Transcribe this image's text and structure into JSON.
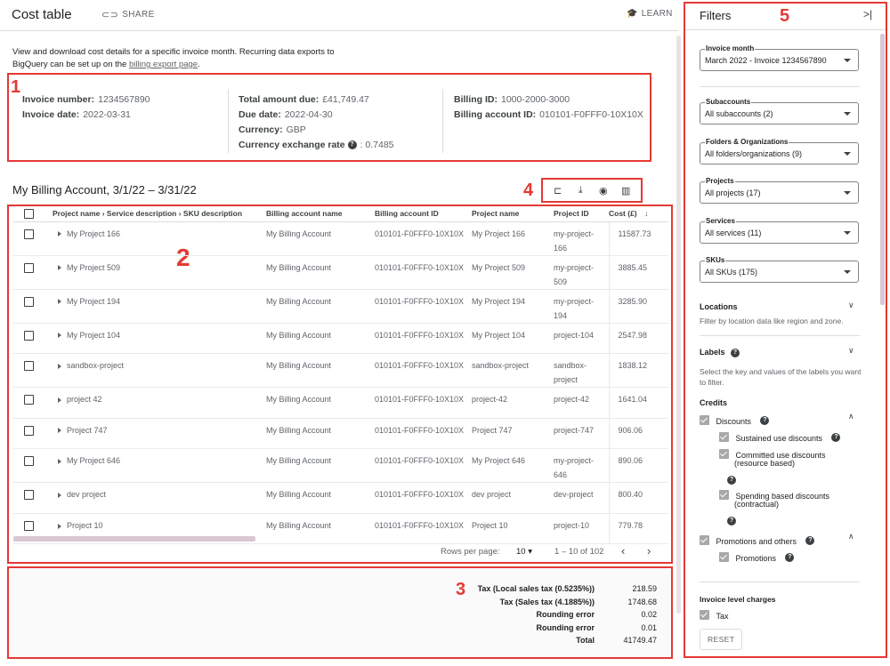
{
  "header": {
    "title": "Cost table",
    "share": "SHARE",
    "learn": "LEARN"
  },
  "intro": {
    "text": "View and download cost details for a specific invoice month. Recurring data exports to BigQuery can be set up on the",
    "link": "billing export page",
    "end": "."
  },
  "callouts": {
    "c1": "1",
    "c2": "2",
    "c3": "3",
    "c4": "4",
    "c5": "5"
  },
  "invoice": {
    "number_label": "Invoice number:",
    "number": "1234567890",
    "date_label": "Invoice date:",
    "date": "2022-03-31",
    "total_label": "Total amount due:",
    "total": "£41,749.47",
    "due_label": "Due date:",
    "due": "2022-04-30",
    "currency_label": "Currency:",
    "currency": "GBP",
    "rate_label": "Currency exchange rate",
    "rate": ": 0.7485",
    "billing_id_label": "Billing ID:",
    "billing_id": "1000-2000-3000",
    "account_id_label": "Billing account ID:",
    "account_id": "010101-F0FFF0-10X10X"
  },
  "account_title": "My Billing Account, 3/1/22 – 3/31/22",
  "table": {
    "headers": [
      "Project name › Service description › SKU description",
      "Billing account name",
      "Billing account ID",
      "Project name",
      "Project ID",
      "Cost (£)"
    ],
    "rows": [
      {
        "name": "My Project 166",
        "acct": "My Billing Account",
        "acct_id": "010101-F0FFF0-10X10X",
        "proj": "My Project 166",
        "pid": "my-project-166",
        "cost": "11587.73"
      },
      {
        "name": "My Project 509",
        "acct": "My Billing Account",
        "acct_id": "010101-F0FFF0-10X10X",
        "proj": "My Project 509",
        "pid": "my-project-509",
        "cost": "3885.45"
      },
      {
        "name": "My Project 194",
        "acct": "My Billing Account",
        "acct_id": "010101-F0FFF0-10X10X",
        "proj": "My Project 194",
        "pid": "my-project-194",
        "cost": "3285.90"
      },
      {
        "name": "My Project 104",
        "acct": "My Billing Account",
        "acct_id": "010101-F0FFF0-10X10X",
        "proj": "My Project 104",
        "pid": "project-104",
        "cost": "2547.98"
      },
      {
        "name": "sandbox-project",
        "acct": "My Billing Account",
        "acct_id": "010101-F0FFF0-10X10X",
        "proj": "sandbox-project",
        "pid": "sandbox-project",
        "cost": "1838.12"
      },
      {
        "name": "project 42",
        "acct": "My Billing Account",
        "acct_id": "010101-F0FFF0-10X10X",
        "proj": "project-42",
        "pid": "project-42",
        "cost": "1641.04"
      },
      {
        "name": "Project 747",
        "acct": "My Billing Account",
        "acct_id": "010101-F0FFF0-10X10X",
        "proj": "Project 747",
        "pid": "project-747",
        "cost": "906.06"
      },
      {
        "name": "My Project 646",
        "acct": "My Billing Account",
        "acct_id": "010101-F0FFF0-10X10X",
        "proj": "My Project 646",
        "pid": "my-project-646",
        "cost": "890.06"
      },
      {
        "name": "dev project",
        "acct": "My Billing Account",
        "acct_id": "010101-F0FFF0-10X10X",
        "proj": "dev project",
        "pid": "dev-project",
        "cost": "800.40"
      },
      {
        "name": "Project 10",
        "acct": "My Billing Account",
        "acct_id": "010101-F0FFF0-10X10X",
        "proj": "Project 10",
        "pid": "project-10",
        "cost": "779.78"
      }
    ]
  },
  "pager": {
    "rows_label": "Rows per page:",
    "rows": "10",
    "range": "1 – 10 of 102"
  },
  "totals": [
    {
      "label": "Tax (Local sales tax (0.5235%))",
      "value": "218.59"
    },
    {
      "label": "Tax (Sales tax (4.1885%))",
      "value": "1748.68"
    },
    {
      "label": "Rounding error",
      "value": "0.02"
    },
    {
      "label": "Rounding error",
      "value": "0.01"
    },
    {
      "label": "Total",
      "value": "41749.47"
    }
  ],
  "filters": {
    "title": "Filters",
    "invoice_month": {
      "label": "Invoice month",
      "value": "March 2022 - Invoice 1234567890"
    },
    "subaccounts": {
      "label": "Subaccounts",
      "value": "All subaccounts (2)"
    },
    "folders": {
      "label": "Folders & Organizations",
      "value": "All folders/organizations (9)"
    },
    "projects": {
      "label": "Projects",
      "value": "All projects (17)"
    },
    "services": {
      "label": "Services",
      "value": "All services (11)"
    },
    "skus": {
      "label": "SKUs",
      "value": "All SKUs (175)"
    },
    "locations": {
      "title": "Locations",
      "desc": "Filter by location data like region and zone."
    },
    "labels": {
      "title": "Labels",
      "desc": "Select the key and values of the labels you want to filter."
    },
    "credits": {
      "title": "Credits",
      "discounts": "Discounts",
      "sustained": "Sustained use discounts",
      "committed1": "Committed use discounts",
      "committed2": "(resource based)",
      "spending1": "Spending based discounts",
      "spending2": "(contractual)",
      "promos_others": "Promotions and others",
      "promotions": "Promotions"
    },
    "invoice_charges": {
      "title": "Invoice level charges",
      "tax": "Tax"
    },
    "reset": "RESET"
  }
}
